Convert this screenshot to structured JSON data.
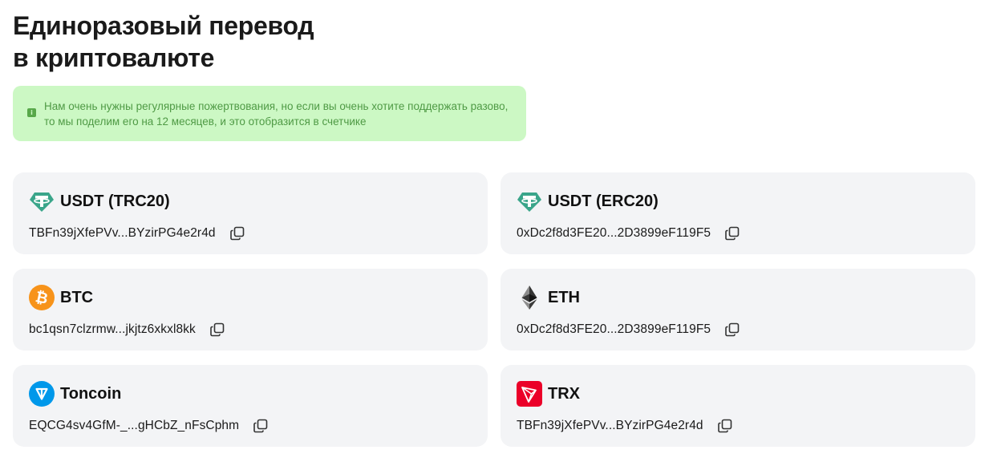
{
  "header": {
    "title_line1": "Единоразовый перевод",
    "title_line2": "в криптовалюте"
  },
  "notice": {
    "icon": "info-icon",
    "text": "Нам очень нужны регулярные пожертвования, но если вы очень хотите поддержать разово, то мы поделим его на 12 месяцев, и это отобразится в счетчике",
    "bg_color": "#ccf8c4",
    "text_color": "#4f9a45"
  },
  "wallets": [
    {
      "name": "USDT (TRC20)",
      "address": "TBFn39jXfePVv...BYzirPG4e2r4d",
      "icon": "tether-icon",
      "color": "#3aa58a"
    },
    {
      "name": "USDT (ERC20)",
      "address": "0xDc2f8d3FE20...2D3899eF119F5",
      "icon": "tether-icon",
      "color": "#3aa58a"
    },
    {
      "name": "BTC",
      "address": "bc1qsn7clzrmw...jkjtz6xkxl8kk",
      "icon": "bitcoin-icon",
      "color": "#f7931a"
    },
    {
      "name": "ETH",
      "address": "0xDc2f8d3FE20...2D3899eF119F5",
      "icon": "ethereum-icon",
      "color": "#343434"
    },
    {
      "name": "Toncoin",
      "address": "EQCG4sv4GfM-_...gHCbZ_nFsCphm",
      "icon": "toncoin-icon",
      "color": "#0098ea"
    },
    {
      "name": "TRX",
      "address": "TBFn39jXfePVv...BYzirPG4e2r4d",
      "icon": "tron-icon",
      "color": "#eb0029"
    }
  ],
  "copy_icon": "copy-icon"
}
